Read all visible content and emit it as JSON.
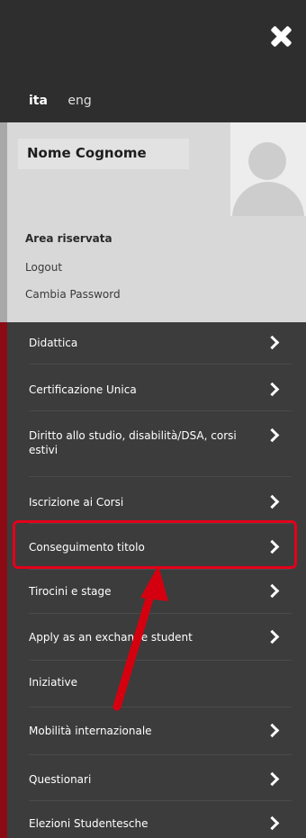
{
  "header": {
    "languages": [
      "ita",
      "eng"
    ]
  },
  "user": {
    "name": "Nome Cognome",
    "section_title": "Area riservata",
    "links": [
      "Logout",
      "Cambia Password"
    ]
  },
  "menu": {
    "items": [
      {
        "label": "Didattica",
        "has_arrow": true
      },
      {
        "label": "Certificazione Unica",
        "has_arrow": true
      },
      {
        "label": "Diritto allo studio, disabilità/DSA, corsi estivi",
        "has_arrow": true
      },
      {
        "label": "Iscrizione ai Corsi",
        "has_arrow": true
      },
      {
        "label": "Conseguimento titolo",
        "has_arrow": true
      },
      {
        "label": "Tirocini e stage",
        "has_arrow": true
      },
      {
        "label": "Apply as an exchange student",
        "has_arrow": true
      },
      {
        "label": "Iniziative",
        "has_arrow": false
      },
      {
        "label": "Mobilità internazionale",
        "has_arrow": true
      },
      {
        "label": "Questionari",
        "has_arrow": true
      },
      {
        "label": "Elezioni Studentesche",
        "has_arrow": true
      }
    ]
  },
  "annotation": {
    "highlight_color": "#e3001b",
    "highlighted_item": "Conseguimento titolo"
  }
}
